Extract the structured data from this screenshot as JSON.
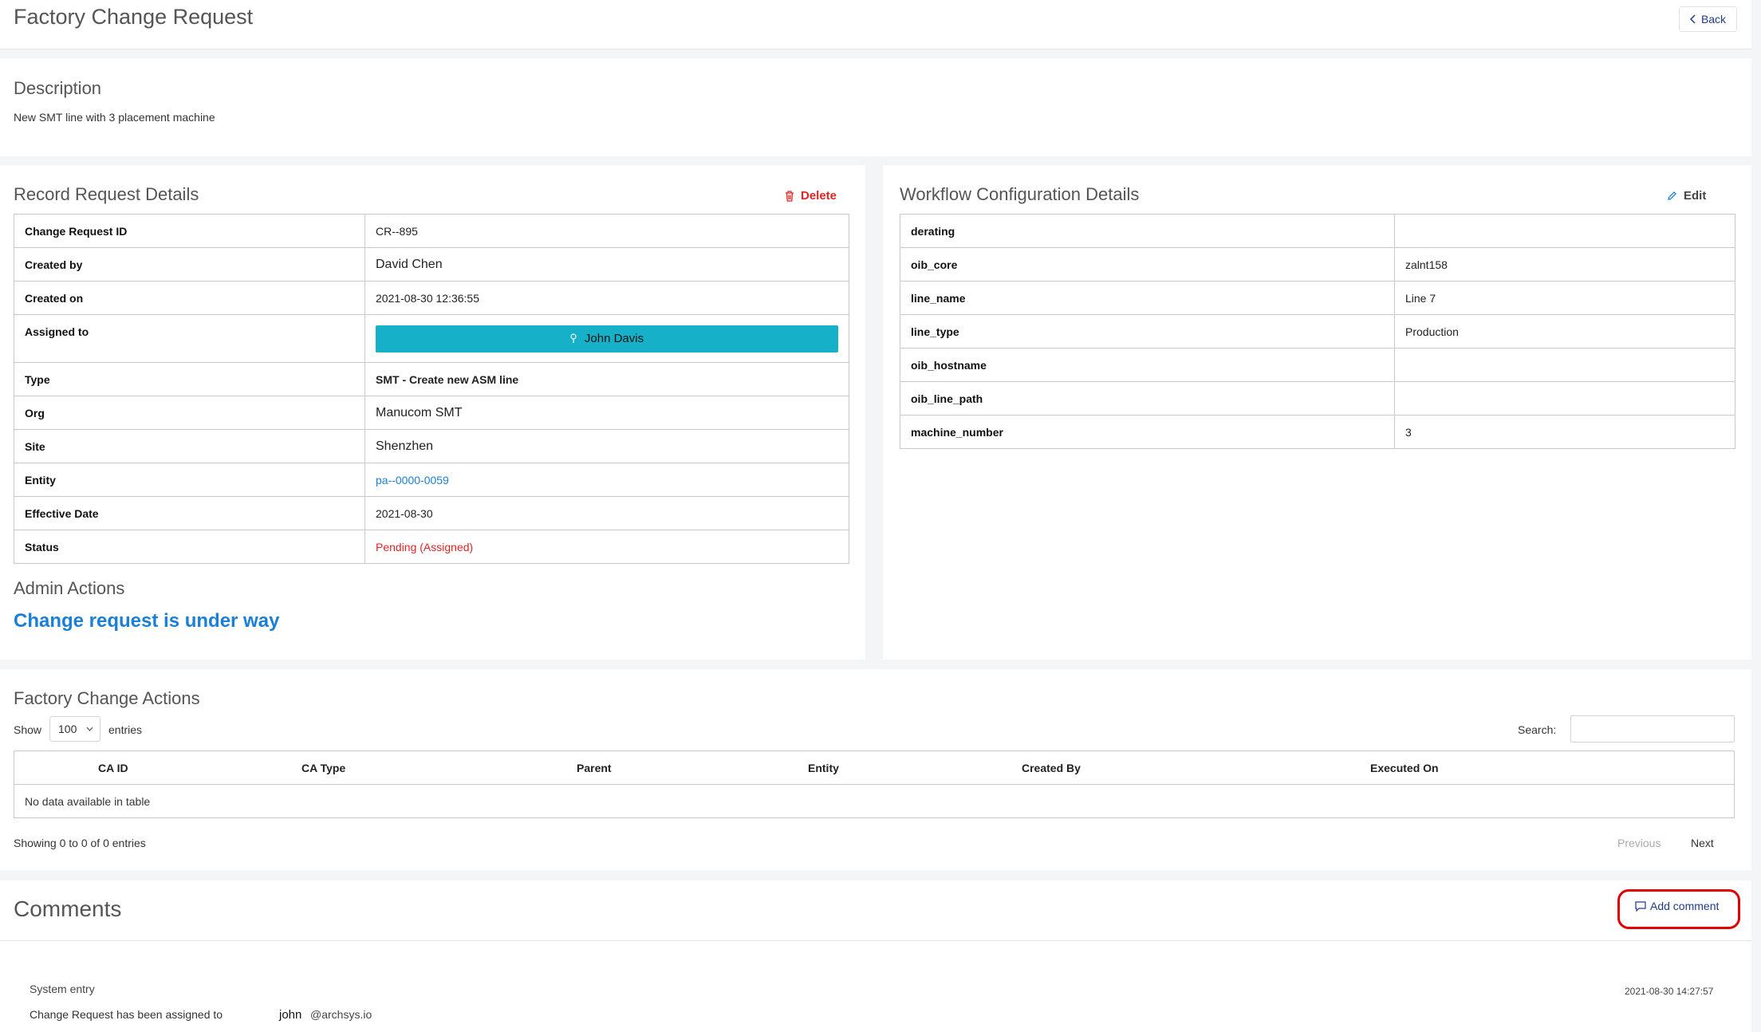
{
  "header": {
    "title": "Factory Change Request",
    "back_label": "Back"
  },
  "description": {
    "title": "Description",
    "text": "New SMT line with 3 placement machine"
  },
  "record": {
    "title": "Record Request Details",
    "delete_label": "Delete",
    "rows": {
      "cr_id": {
        "label": "Change Request ID",
        "value": "CR--895"
      },
      "created_by": {
        "label": "Created by",
        "value": "David Chen"
      },
      "created_on": {
        "label": "Created on",
        "value": "2021-08-30 12:36:55"
      },
      "assigned_to": {
        "label": "Assigned to",
        "value": "John Davis"
      },
      "type": {
        "label": "Type",
        "value": "SMT - Create new ASM line"
      },
      "org": {
        "label": "Org",
        "value": "Manucom SMT"
      },
      "site": {
        "label": "Site",
        "value": "Shenzhen"
      },
      "entity": {
        "label": "Entity",
        "value": "pa--0000-0059"
      },
      "effective_date": {
        "label": "Effective Date",
        "value": "2021-08-30"
      },
      "status": {
        "label": "Status",
        "value": "Pending (Assigned)"
      }
    },
    "admin_title": "Admin Actions",
    "admin_status": "Change request is under way"
  },
  "workflow": {
    "title": "Workflow Configuration Details",
    "edit_label": "Edit",
    "rows": [
      {
        "key": "derating",
        "value": ""
      },
      {
        "key": "oib_core",
        "value": "zalnt158"
      },
      {
        "key": "line_name",
        "value": "Line 7"
      },
      {
        "key": "line_type",
        "value": "Production"
      },
      {
        "key": "oib_hostname",
        "value": ""
      },
      {
        "key": "oib_line_path",
        "value": ""
      },
      {
        "key": "machine_number",
        "value": "3"
      }
    ]
  },
  "actions": {
    "title": "Factory Change Actions",
    "show_label": "Show",
    "entries_value": "100",
    "entries_label": "entries",
    "search_label": "Search:",
    "search_value": "",
    "columns": [
      "CA ID",
      "CA Type",
      "Parent",
      "Entity",
      "Created By",
      "Executed On"
    ],
    "empty_text": "No data available in table",
    "info": "Showing 0 to 0 of 0 entries",
    "prev_label": "Previous",
    "next_label": "Next"
  },
  "comments": {
    "title": "Comments",
    "add_label": "Add comment",
    "entry": {
      "author": "System entry",
      "timestamp": "2021-08-30 14:27:57",
      "text": "Change Request has been assigned to",
      "user": "john",
      "domain": "@archsys.io"
    }
  },
  "colors": {
    "assign_button": "#17b0c9",
    "link": "#1a7fd6",
    "status": "#e02424",
    "delete": "#e02424",
    "highlight": "#e00000"
  }
}
